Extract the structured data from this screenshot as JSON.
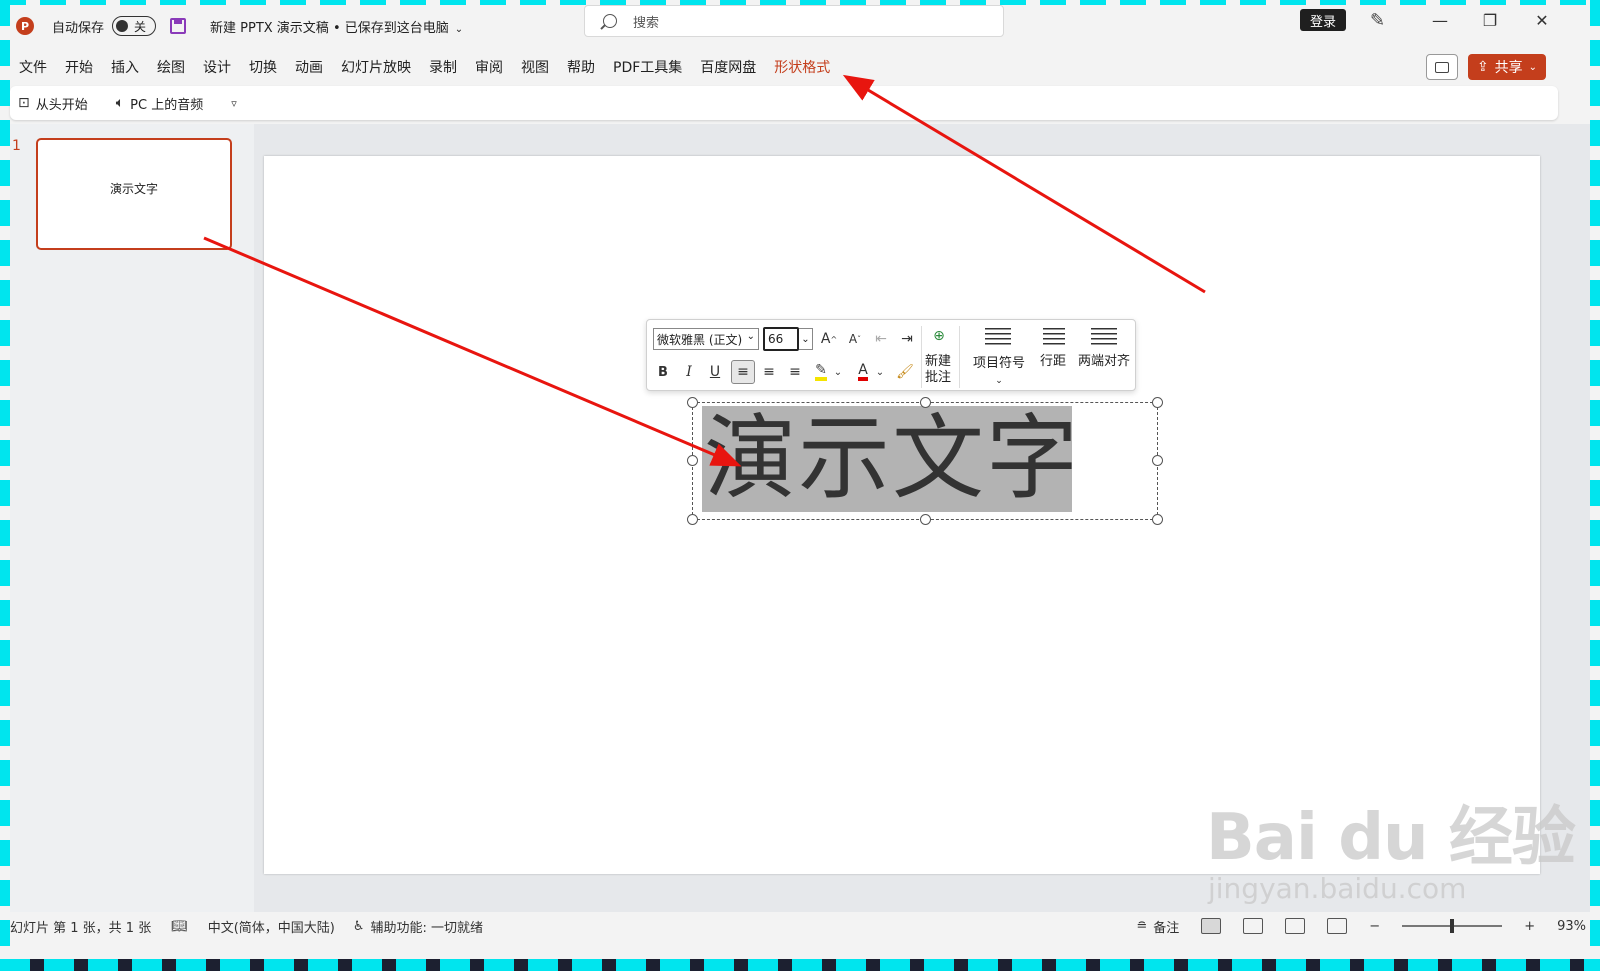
{
  "titlebar": {
    "app_icon_letter": "P",
    "autosave_label": "自动保存",
    "autosave_state": "关",
    "document_title": "新建 PPTX 演示文稿 • 已保存到这台电脑",
    "search_placeholder": "搜索",
    "login_label": "登录"
  },
  "menu": {
    "items": [
      "文件",
      "开始",
      "插入",
      "绘图",
      "设计",
      "切换",
      "动画",
      "幻灯片放映",
      "录制",
      "审阅",
      "视图",
      "帮助",
      "PDF工具集",
      "百度网盘",
      "形状格式"
    ],
    "active": "形状格式",
    "share_label": "共享"
  },
  "qat": {
    "from_start": "从头开始",
    "pc_audio": "PC 上的音频"
  },
  "thumbnails": {
    "slide_number": "1",
    "slide_text": "演示文字"
  },
  "mini_toolbar": {
    "font": "微软雅黑 (正文)",
    "size": "66",
    "new_comment_line1": "新建",
    "new_comment_line2": "批注",
    "bullets": "项目符号",
    "line_spacing": "行距",
    "justify": "两端对齐",
    "bold": "B",
    "italic": "I",
    "underline": "U",
    "grow_font": "A",
    "shrink_font": "A"
  },
  "slide": {
    "text": "演示文字"
  },
  "statusbar": {
    "slide_info": "幻灯片 第 1 张，共 1 张",
    "language": "中文(简体，中国大陆)",
    "accessibility": "辅助功能: 一切就绪",
    "notes": "备注",
    "zoom": "93%"
  },
  "watermark": {
    "main": "Bai du 经验",
    "sub": "jingyan.baidu.com"
  },
  "colors": {
    "accent": "#c43e1c",
    "frame": "#00e5ee",
    "arrow": "#e8150f",
    "selection_bg": "#b3b3b3"
  }
}
